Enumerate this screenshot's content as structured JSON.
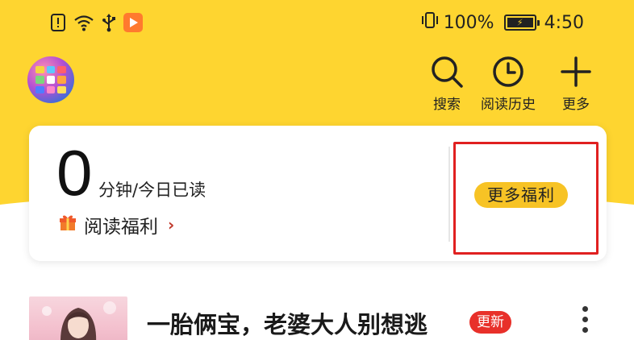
{
  "status_bar": {
    "icons_left": [
      "alert-icon",
      "wifi-icon",
      "usb-icon",
      "video-app-icon"
    ],
    "icons_right": [
      "vibrate-icon",
      "battery-icon"
    ],
    "battery": "100%",
    "battery_level": 1.0,
    "time": "4:50"
  },
  "header": {
    "search": "搜索",
    "history": "阅读历史",
    "more": "更多"
  },
  "reading_card": {
    "minutes": "0",
    "minutes_label": "分钟/今日已读",
    "welfare_label": "阅读福利",
    "welfare_arrow": "›",
    "more_welfare": "更多福利"
  },
  "book": {
    "title": "一胎俩宝，老婆大人别想逃",
    "badge": "更新"
  },
  "colors": {
    "header_yellow": "#fed530",
    "pill_yellow": "#f7c325",
    "badge_red": "#e8302a",
    "highlight_red": "#e02020"
  }
}
